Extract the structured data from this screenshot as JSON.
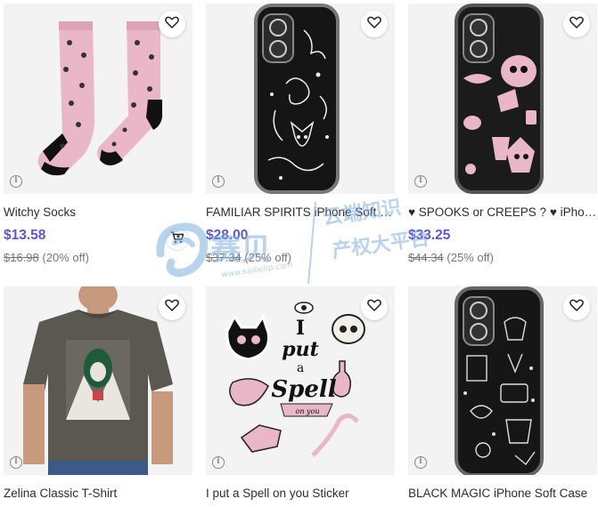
{
  "products": [
    {
      "title": "Witchy Socks",
      "price": "$13.58",
      "original_price": "$16.98",
      "discount": "(20% off)"
    },
    {
      "title": "FAMILIAR SPIRITS iPhone Soft Ca...",
      "price": "$28.00",
      "original_price": "$37.34",
      "discount": "(25% off)"
    },
    {
      "title": "♥ SPOOKS or CREEPS ? ♥ iPhone ...",
      "price": "$33.25",
      "original_price": "$44.34",
      "discount": "(25% off)"
    },
    {
      "title": "Zelina Classic T-Shirt"
    },
    {
      "title": "I put a Spell on you Sticker"
    },
    {
      "title": "BLACK MAGIC iPhone Soft Case"
    }
  ],
  "sticker_text": {
    "line1": "I",
    "line2": "put",
    "line3": "a",
    "line4": "Spell",
    "line5": "on you"
  },
  "watermark": {
    "cn_line1": "云端知识",
    "cn_line2": "产权大平台",
    "brand": "赛贝",
    "url": "www.saibeiip.com"
  },
  "icons": {
    "favorite": "heart-outline-icon",
    "info": "info-icon",
    "cart": "add-to-cart-icon"
  },
  "colors": {
    "price": "#5b57d1",
    "watermark": "#7fb0e0",
    "pink": "#e9b7c8"
  }
}
